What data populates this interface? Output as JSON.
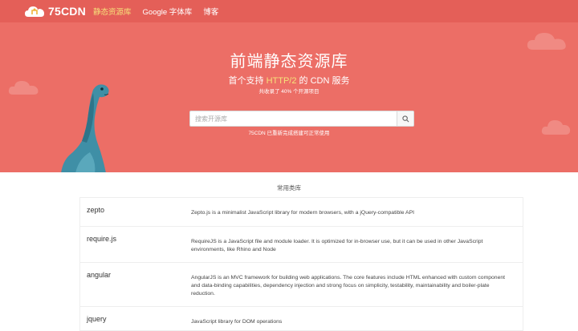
{
  "nav": {
    "brand": "75CDN",
    "links": [
      {
        "label": "静态资源库",
        "active": true
      },
      {
        "label": "Google 字体库",
        "active": false
      },
      {
        "label": "博客",
        "active": false
      }
    ]
  },
  "hero": {
    "title": "前端静态资源库",
    "subtitle_before": "首个支持 ",
    "subtitle_highlight": "HTTP/2",
    "subtitle_after": " 的 CDN 服务",
    "note": "共收录了 40% 个开源项目",
    "search_placeholder": "搜索开源库",
    "hint": "75CDN 已重新完成搭建可正常使用"
  },
  "library_section": {
    "title": "常用类库",
    "rows": [
      {
        "name": "zepto",
        "description": "Zepto.js is a minimalist JavaScript library for modern browsers, with a jQuery-compatible API"
      },
      {
        "name": "require.js",
        "description": "RequireJS is a JavaScript file and module loader. It is optimized for in-browser use, but it can be used in other JavaScript environments, like Rhino and Node"
      },
      {
        "name": "angular",
        "description": "AngularJS is an MVC framework for building web applications. The core features include HTML enhanced with custom component and data-binding capabilities, dependency injection and strong focus on simplicity, testability, maintainability and boiler-plate reduction."
      },
      {
        "name": "jquery",
        "description": "JavaScript library for DOM operations"
      }
    ]
  },
  "colors": {
    "nav_bg": "#e45f58",
    "hero_bg": "#ec6e66",
    "highlight": "#f6e27a",
    "dino": "#3f8fa6"
  },
  "icons": {
    "logo": "cloud-logo-icon",
    "search": "search-icon",
    "mascot": "dinosaur-mascot"
  }
}
